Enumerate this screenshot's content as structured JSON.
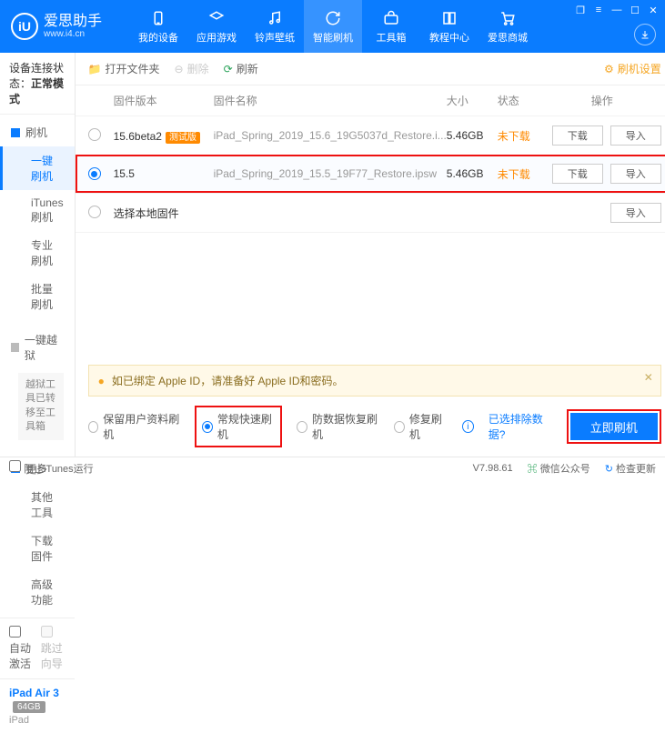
{
  "app": {
    "name": "爱思助手",
    "url": "www.i4.cn"
  },
  "nav": {
    "items": [
      {
        "label": "我的设备"
      },
      {
        "label": "应用游戏"
      },
      {
        "label": "铃声壁纸"
      },
      {
        "label": "智能刷机"
      },
      {
        "label": "工具箱"
      },
      {
        "label": "教程中心"
      },
      {
        "label": "爱思商城"
      }
    ]
  },
  "sidebar": {
    "status_label": "设备连接状态：",
    "status_value": "正常模式",
    "flash": {
      "head": "刷机",
      "items": [
        "一键刷机",
        "iTunes刷机",
        "专业刷机",
        "批量刷机"
      ]
    },
    "jailbreak": {
      "head": "一键越狱",
      "note": "越狱工具已转移至工具箱"
    },
    "more": {
      "head": "更多",
      "items": [
        "其他工具",
        "下载固件",
        "高级功能"
      ]
    },
    "auto_activate": "自动激活",
    "skip_guide": "跳过向导",
    "device": {
      "name": "iPad Air 3",
      "storage": "64GB",
      "kind": "iPad"
    }
  },
  "toolbar": {
    "open_folder": "打开文件夹",
    "delete": "删除",
    "refresh": "刷新",
    "settings": "刷机设置"
  },
  "table": {
    "headers": {
      "version": "固件版本",
      "name": "固件名称",
      "size": "大小",
      "status": "状态",
      "ops": "操作"
    },
    "rows": [
      {
        "version": "15.6beta2",
        "beta": "测试版",
        "name": "iPad_Spring_2019_15.6_19G5037d_Restore.i...",
        "size": "5.46GB",
        "status": "未下载"
      },
      {
        "version": "15.5",
        "name": "iPad_Spring_2019_15.5_19F77_Restore.ipsw",
        "size": "5.46GB",
        "status": "未下载"
      }
    ],
    "local_label": "选择本地固件",
    "btn_download": "下载",
    "btn_import": "导入"
  },
  "warn": {
    "text": "如已绑定 Apple ID，请准备好 Apple ID和密码。"
  },
  "modes": {
    "keep_data": "保留用户资料刷机",
    "normal": "常规快速刷机",
    "anti_recovery": "防数据恢复刷机",
    "repair": "修复刷机",
    "exclude_link": "已选排除数据?",
    "primary": "立即刷机"
  },
  "footer": {
    "block_itunes": "阻止iTunes运行",
    "version": "V7.98.61",
    "wechat": "微信公众号",
    "check_update": "检查更新"
  }
}
